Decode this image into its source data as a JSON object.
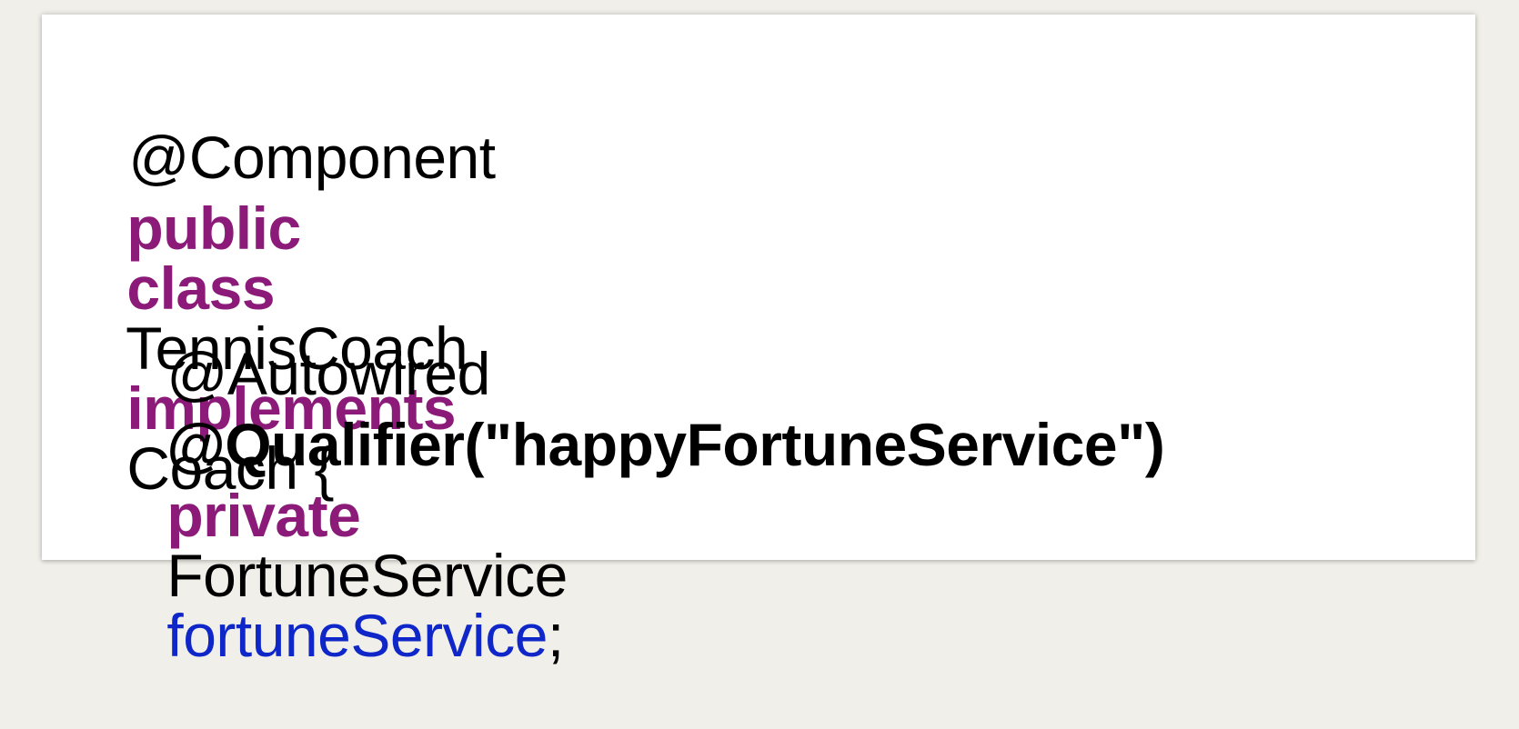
{
  "colors": {
    "background": "#f1efe9",
    "panel": "#ffffff",
    "keyword": "#8b1a78",
    "field": "#0f27c8",
    "text": "#000000"
  },
  "code": {
    "line1": {
      "annotation": "@Component"
    },
    "line2": {
      "kw_public": "public",
      "kw_class": "class",
      "class_name": "TennisCoach",
      "kw_implements": "implements",
      "interface_name": "Coach {"
    },
    "line4": {
      "annotation": "@Autowired"
    },
    "line5": {
      "annotation": "@Qualifier(\"happyFortuneService\")"
    },
    "line6": {
      "kw_private": "private",
      "type_name": "FortuneService",
      "field_name": "fortuneService",
      "terminator": ";"
    }
  }
}
